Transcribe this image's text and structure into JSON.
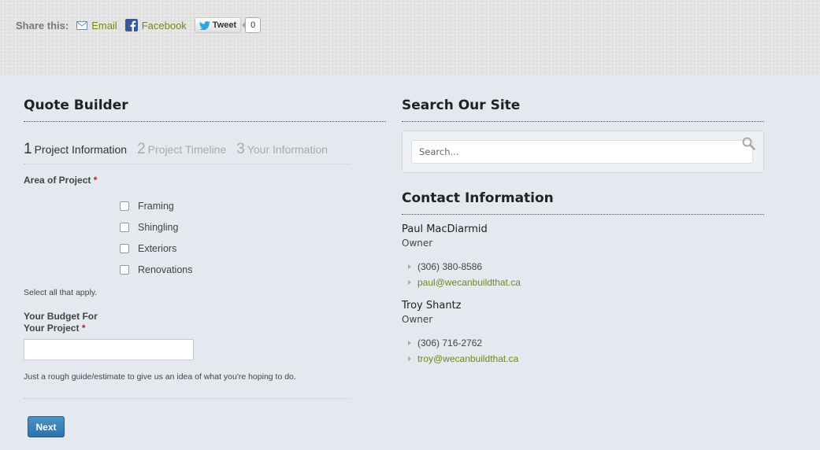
{
  "share": {
    "label": "Share this:",
    "email_label": "Email",
    "facebook_label": "Facebook",
    "tweet_label": "Tweet",
    "tweet_count": "0"
  },
  "quote": {
    "title": "Quote Builder",
    "steps": [
      {
        "num": "1",
        "label": "Project Information"
      },
      {
        "num": "2",
        "label": "Project Timeline"
      },
      {
        "num": "3",
        "label": "Your Information"
      }
    ],
    "area_label": "Area of Project",
    "required_mark": "*",
    "options": [
      "Framing",
      "Shingling",
      "Exteriors",
      "Renovations"
    ],
    "options_help": "Select all that apply.",
    "budget_label_1": "Your Budget For",
    "budget_label_2": "Your Project",
    "budget_value": "",
    "budget_help": "Just a rough guide/estimate to give us an idea of what you're hoping to do.",
    "next_label": "Next"
  },
  "search": {
    "title": "Search Our Site",
    "placeholder": "Search..."
  },
  "contact": {
    "title": "Contact Information",
    "people": [
      {
        "name": "Paul MacDiarmid",
        "role": "Owner",
        "phone": "(306) 380-8586",
        "email": "paul@wecanbuildthat.ca"
      },
      {
        "name": "Troy Shantz",
        "role": "Owner",
        "phone": "(306) 716-2762",
        "email": "troy@wecanbuildthat.ca"
      }
    ]
  },
  "colors": {
    "link_green": "#6b8a1e",
    "button_blue": "#3a82b8",
    "required_red": "#b0232a",
    "page_bg": "#e4e8ef"
  }
}
